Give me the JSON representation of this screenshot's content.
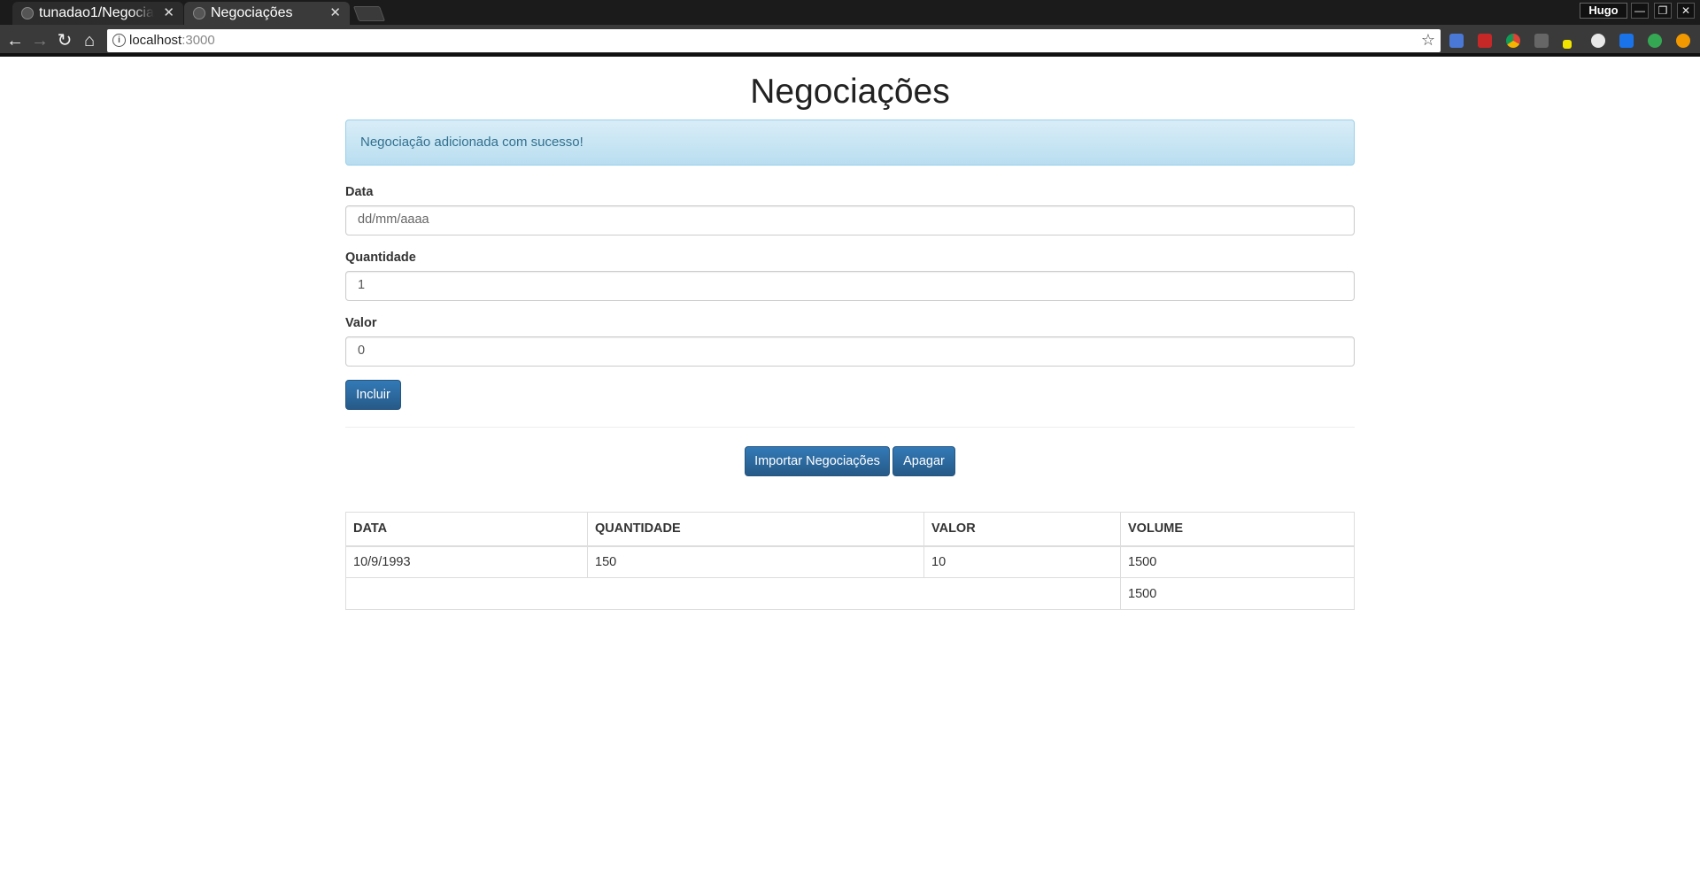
{
  "browser": {
    "tabs": [
      {
        "title": "tunadao1/Negociações",
        "close": "✕"
      },
      {
        "title": "Negociações",
        "close": "✕"
      }
    ],
    "profile": "Hugo",
    "window_buttons": {
      "minimize": "—",
      "restore": "❐",
      "close": "✕"
    },
    "url_host": "localhost",
    "url_port": ":3000",
    "extensions": [
      "google-translate-icon",
      "lastpass-icon",
      "chrome-circle-icon",
      "shield-icon",
      "note-icon",
      "sphere-icon",
      "s-icon",
      "green-icon",
      "orange-icon"
    ]
  },
  "page": {
    "title": "Negociações",
    "alert": "Negociação adicionada com sucesso!",
    "form": {
      "data_label": "Data",
      "data_placeholder": "dd/mm/aaaa",
      "quantidade_label": "Quantidade",
      "quantidade_value": "1",
      "valor_label": "Valor",
      "valor_value": "0",
      "submit_label": "Incluir"
    },
    "actions": {
      "import_label": "Importar Negociações",
      "clear_label": "Apagar"
    },
    "table": {
      "headers": [
        "DATA",
        "QUANTIDADE",
        "VALOR",
        "VOLUME"
      ],
      "rows": [
        [
          "10/9/1993",
          "150",
          "10",
          "1500"
        ]
      ],
      "total": "1500"
    }
  },
  "colors": {
    "primary": "#337ab7",
    "alert_bg": "#d9edf7",
    "alert_text": "#31708f"
  }
}
